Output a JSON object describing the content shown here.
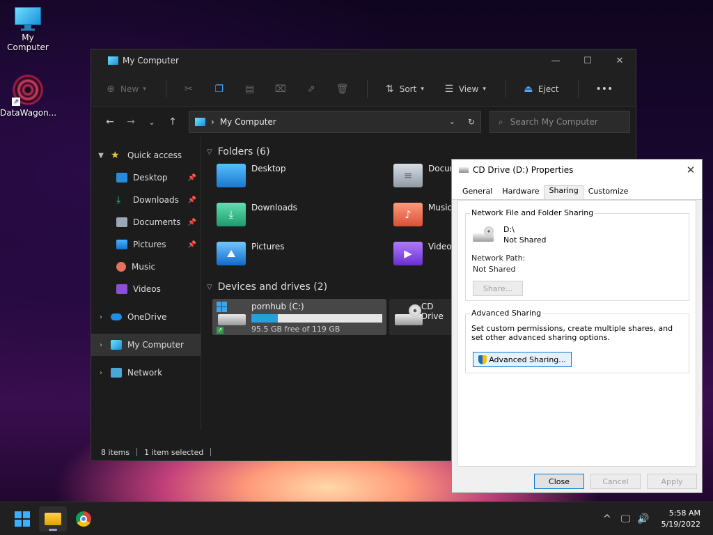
{
  "desktop": {
    "icons": [
      {
        "label": "My Computer"
      },
      {
        "label": "DataWagon..."
      }
    ]
  },
  "explorer": {
    "title": "My Computer",
    "toolbar": {
      "new_label": "New",
      "sort_label": "Sort",
      "view_label": "View",
      "eject_label": "Eject",
      "more_label": "•••"
    },
    "address": {
      "path": "My Computer",
      "search_placeholder": "Search My Computer"
    },
    "sidebar": {
      "quick_access": "Quick access",
      "items": [
        "Desktop",
        "Downloads",
        "Documents",
        "Pictures",
        "Music",
        "Videos"
      ],
      "onedrive": "OneDrive",
      "my_computer": "My Computer",
      "network": "Network"
    },
    "folders_header": "Folders (6)",
    "folders": [
      "Desktop",
      "Documents",
      "Downloads",
      "Music",
      "Pictures",
      "Videos"
    ],
    "devices_header": "Devices and drives (2)",
    "drives": [
      {
        "name": "pornhub (C:)",
        "free_text": "95.5 GB free of 119 GB",
        "used_fraction": 0.2
      },
      {
        "name": "CD Drive"
      }
    ],
    "status": {
      "items": "8 items",
      "selected": "1 item selected"
    }
  },
  "dialog": {
    "title": "CD Drive (D:) Properties",
    "tabs": [
      "General",
      "Hardware",
      "Sharing",
      "Customize"
    ],
    "selected_tab": "Sharing",
    "network_sharing": {
      "legend": "Network File and Folder Sharing",
      "drive_path": "D:\\",
      "drive_status": "Not Shared",
      "network_path_label": "Network Path:",
      "network_path_value": "Not Shared",
      "share_button": "Share..."
    },
    "advanced_sharing": {
      "legend": "Advanced Sharing",
      "description": "Set custom permissions, create multiple shares, and set other advanced sharing options.",
      "button": "Advanced Sharing..."
    },
    "buttons": {
      "close": "Close",
      "cancel": "Cancel",
      "apply": "Apply"
    }
  },
  "taskbar": {
    "time": "5:58 AM",
    "date": "5/19/2022"
  }
}
